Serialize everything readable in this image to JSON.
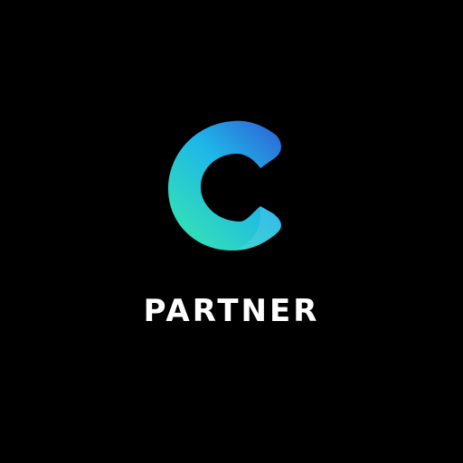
{
  "app": {
    "label": "PARTNER",
    "logo_icon": "c-letter-logo-icon"
  },
  "colors": {
    "background": "#000000",
    "label": "#ffffff",
    "logo_gradient_start": "#2F5FD6",
    "logo_gradient_mid": "#1FB6E8",
    "logo_gradient_end": "#35E5B0"
  }
}
